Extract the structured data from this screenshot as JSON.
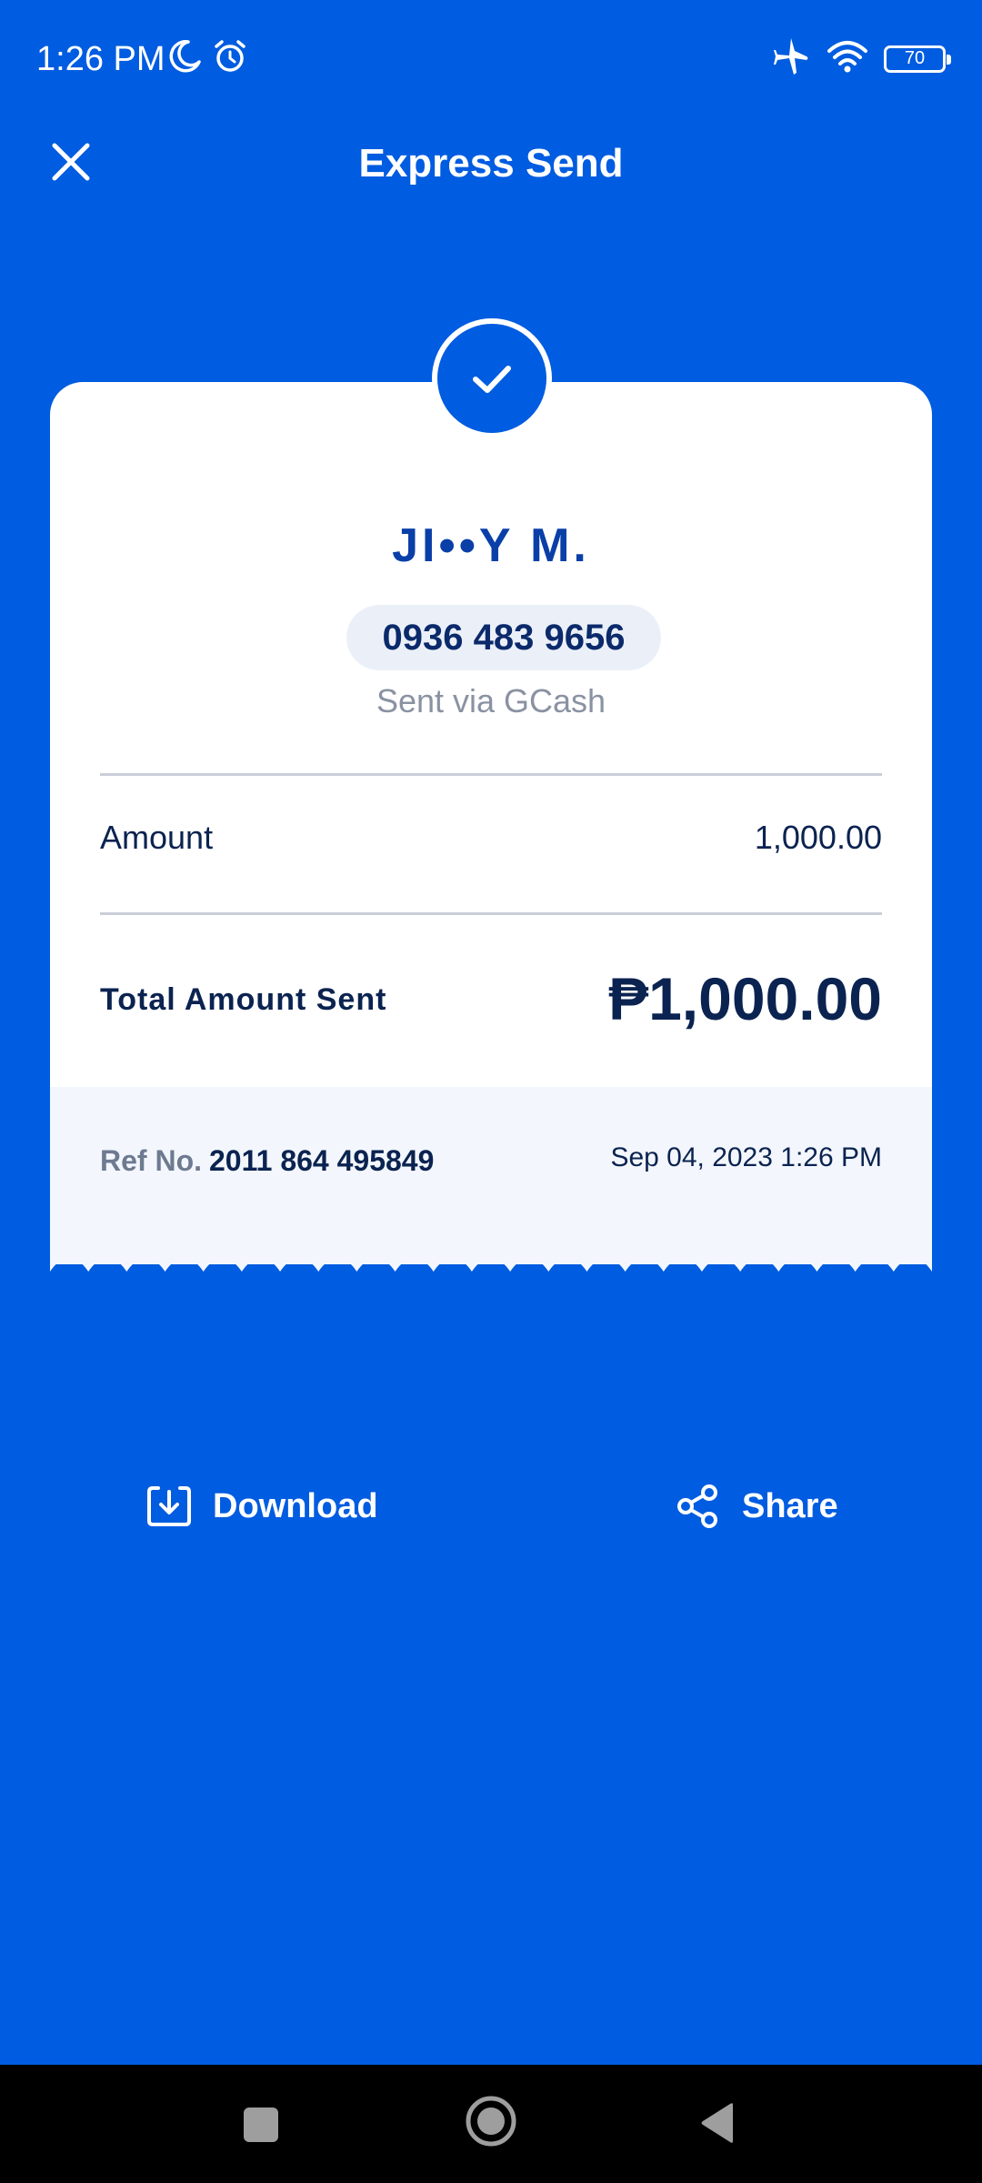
{
  "status_bar": {
    "time": "1:26 PM",
    "battery_level": "70",
    "icons": [
      "moon-icon",
      "alarm-icon",
      "airplane-icon",
      "wifi-icon",
      "battery-icon"
    ]
  },
  "header": {
    "title": "Express Send",
    "close_icon": "close-icon"
  },
  "receipt": {
    "recipient_name": "JI••Y M.",
    "phone": "0936 483 9656",
    "sent_via": "Sent via GCash",
    "amount_label": "Amount",
    "amount_value": "1,000.00",
    "total_label": "Total Amount Sent",
    "total_value": "₱1,000.00",
    "ref_label": "Ref No.",
    "ref_number": "2011 864 495849",
    "date": "Sep 04, 2023 1:26 PM"
  },
  "actions": {
    "download_label": "Download",
    "share_label": "Share"
  },
  "colors": {
    "background": "#005CE0",
    "card": "#FFFFFF",
    "card_footer": "#F3F7FD",
    "accent_text": "#0A3FA8",
    "dark_text": "#0B2350"
  }
}
